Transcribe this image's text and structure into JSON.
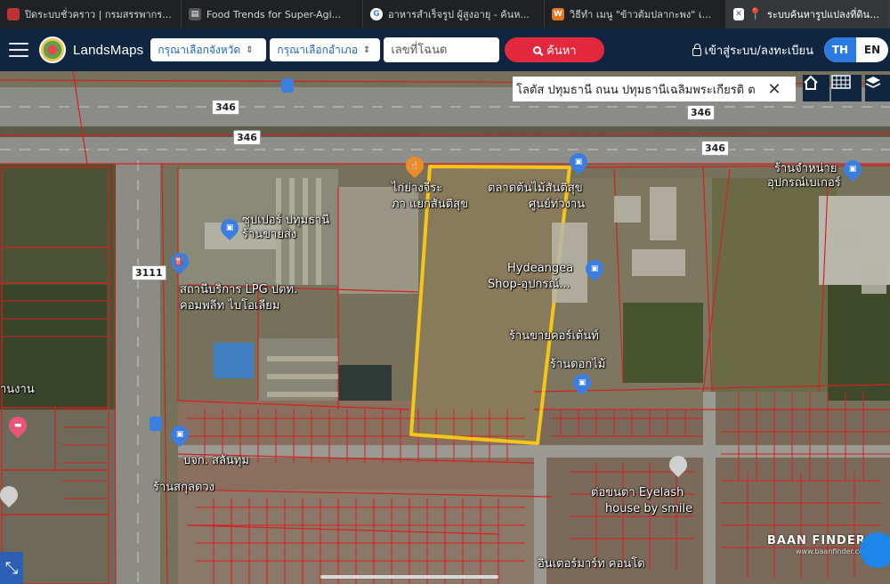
{
  "browser": {
    "tabs": [
      {
        "title": "ปิดระบบชั่วคราว | กรมสรรพากร...",
        "icon_color": "#b33"
      },
      {
        "title": "Food Trends for Super-Agi...",
        "icon_color": "#555"
      },
      {
        "title": "อาหารสำเร็จรูป ผู้สูงอายุ - ค้นห...",
        "icon_color": "#4285f4"
      },
      {
        "title": "วิธีทำ เมนู \"ข้าวต้มปลากะพง\" เ...",
        "icon_color": "#e8731d"
      },
      {
        "title": "ระบบค้นหารูปแปลงที่ดิน (Land...",
        "icon_color": "#e3283e"
      }
    ]
  },
  "header": {
    "brand": "LandsMaps",
    "province_select": "กรุณาเลือกจังหวัด",
    "district_select": "กรุณาเลือกอำเภอ",
    "deed_placeholder": "เลขที่โฉนด",
    "search_label": "ค้นหา",
    "login_label": "เข้าสู่ระบบ/ลงทะเบียน",
    "lang_th": "TH",
    "lang_en": "EN"
  },
  "map": {
    "search_value": "โลตัส ปทุมธานี ถนน ปทุมธานีเฉลิมพระเกียรติ ต",
    "road_badges": [
      "346",
      "346",
      "346",
      "346",
      "3111"
    ],
    "places": [
      "ไก่ย่างจีระ",
      "ภา แยกสันติสุข",
      "ตลาดต้นไม้สันติสุข",
      "ศูนย์ท่วงาน",
      "ซุปเปอร์ ปทุมธานี",
      "ร้านขายส่ง",
      "Hydeangea",
      "Shop-อุปกรณ์...",
      "สถานีบริการ LPG ปตท.",
      "คอมพลีท ไบโอเลียม",
      "ร้านขายคอร์เต้นท์",
      "ร้านดอกไม้",
      "ร้านจำหน่าย",
      "อุปกรณ์เบเกอร์",
      "บจก. สลันทุม",
      "ร้านสกุลดวง",
      "ต่อขนตา Eyelash",
      "house by smile",
      "อินเตอร์มาร์ท คอนโด",
      "านงาน"
    ],
    "watermark": "BAAN FINDER",
    "watermark_url": "www.baanfinder.com",
    "colors": {
      "parcel_border": "#d42020",
      "highlight": "#f5c518"
    }
  }
}
